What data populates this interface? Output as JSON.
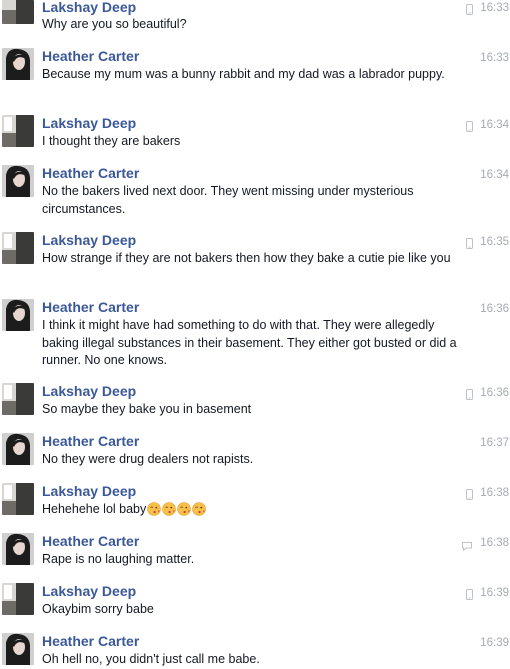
{
  "messages": [
    {
      "sender": "Lakshay Deep",
      "text": "Why are you so beautiful?",
      "time": "16:33",
      "status_icon": "mobile-icon"
    },
    {
      "sender": "Heather Carter",
      "text": "Because my mum was a bunny rabbit and my dad was a labrador puppy.",
      "time": "16:33",
      "status_icon": ""
    },
    {
      "sender": "Lakshay Deep",
      "text": "I thought they are bakers",
      "time": "16:34",
      "status_icon": "mobile-icon"
    },
    {
      "sender": "Heather Carter",
      "text": "No the bakers lived next door. They went missing under mysterious circumstances.",
      "time": "16:34",
      "status_icon": ""
    },
    {
      "sender": "Lakshay Deep",
      "text": "How strange if they are not bakers then how they bake a cutie pie like you",
      "time": "16:35",
      "status_icon": "mobile-icon"
    },
    {
      "sender": "Heather Carter",
      "text": "I think it might have had something to do with that. They were allegedly baking illegal substances in their basement. They either got busted or did a runner. No one knows.",
      "time": "16:36",
      "status_icon": ""
    },
    {
      "sender": "Lakshay Deep",
      "text": "So maybe they bake you in basement",
      "time": "16:36",
      "status_icon": "mobile-icon"
    },
    {
      "sender": "Heather Carter",
      "text": "No they were drug dealers not rapists.",
      "time": "16:37",
      "status_icon": ""
    },
    {
      "sender": "Lakshay Deep",
      "text": "Hehehehe lol baby",
      "time": "16:38",
      "status_icon": "mobile-icon",
      "emojis": [
        "kiss-emoji",
        "kiss-emoji",
        "kiss-emoji",
        "kiss-emoji"
      ]
    },
    {
      "sender": "Heather Carter",
      "text": "Rape is no laughing matter.",
      "time": "16:38",
      "status_icon": "chat-bubble-icon"
    },
    {
      "sender": "Lakshay Deep",
      "text": "Okaybim sorry babe",
      "time": "16:39",
      "status_icon": "mobile-icon"
    },
    {
      "sender": "Heather Carter",
      "text": "Oh hell no, you didn't just call me babe.",
      "time": "16:39",
      "status_icon": ""
    }
  ],
  "colors": {
    "name": "#3b5998",
    "text": "#141823",
    "time": "#a7abb1"
  }
}
